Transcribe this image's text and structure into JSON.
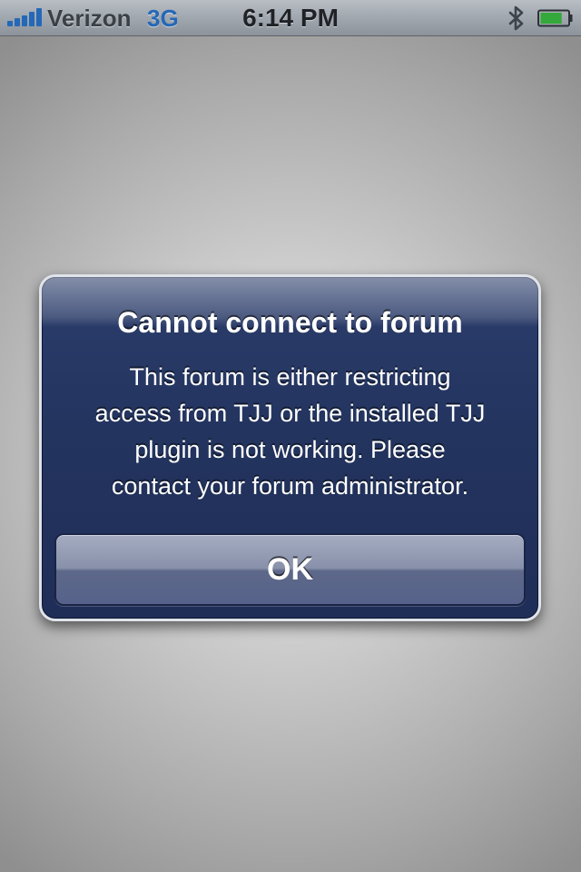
{
  "status_bar": {
    "carrier": "Verizon",
    "network": "3G",
    "time": "6:14 PM",
    "icons": [
      "signal-bars-icon",
      "bluetooth-icon",
      "battery-icon"
    ],
    "battery_level": 0.8,
    "signal_bars": 5
  },
  "alert": {
    "title": "Cannot connect to forum",
    "message_lines": [
      "This forum is either restricting",
      "access from TJJ or the installed TJJ",
      "plugin is not working. Please",
      "contact your forum administrator."
    ],
    "ok_button_label": "OK"
  },
  "colors": {
    "alert_background": "#23345f",
    "status_accent": "#2468b8",
    "battery_fill": "#34a83a"
  }
}
